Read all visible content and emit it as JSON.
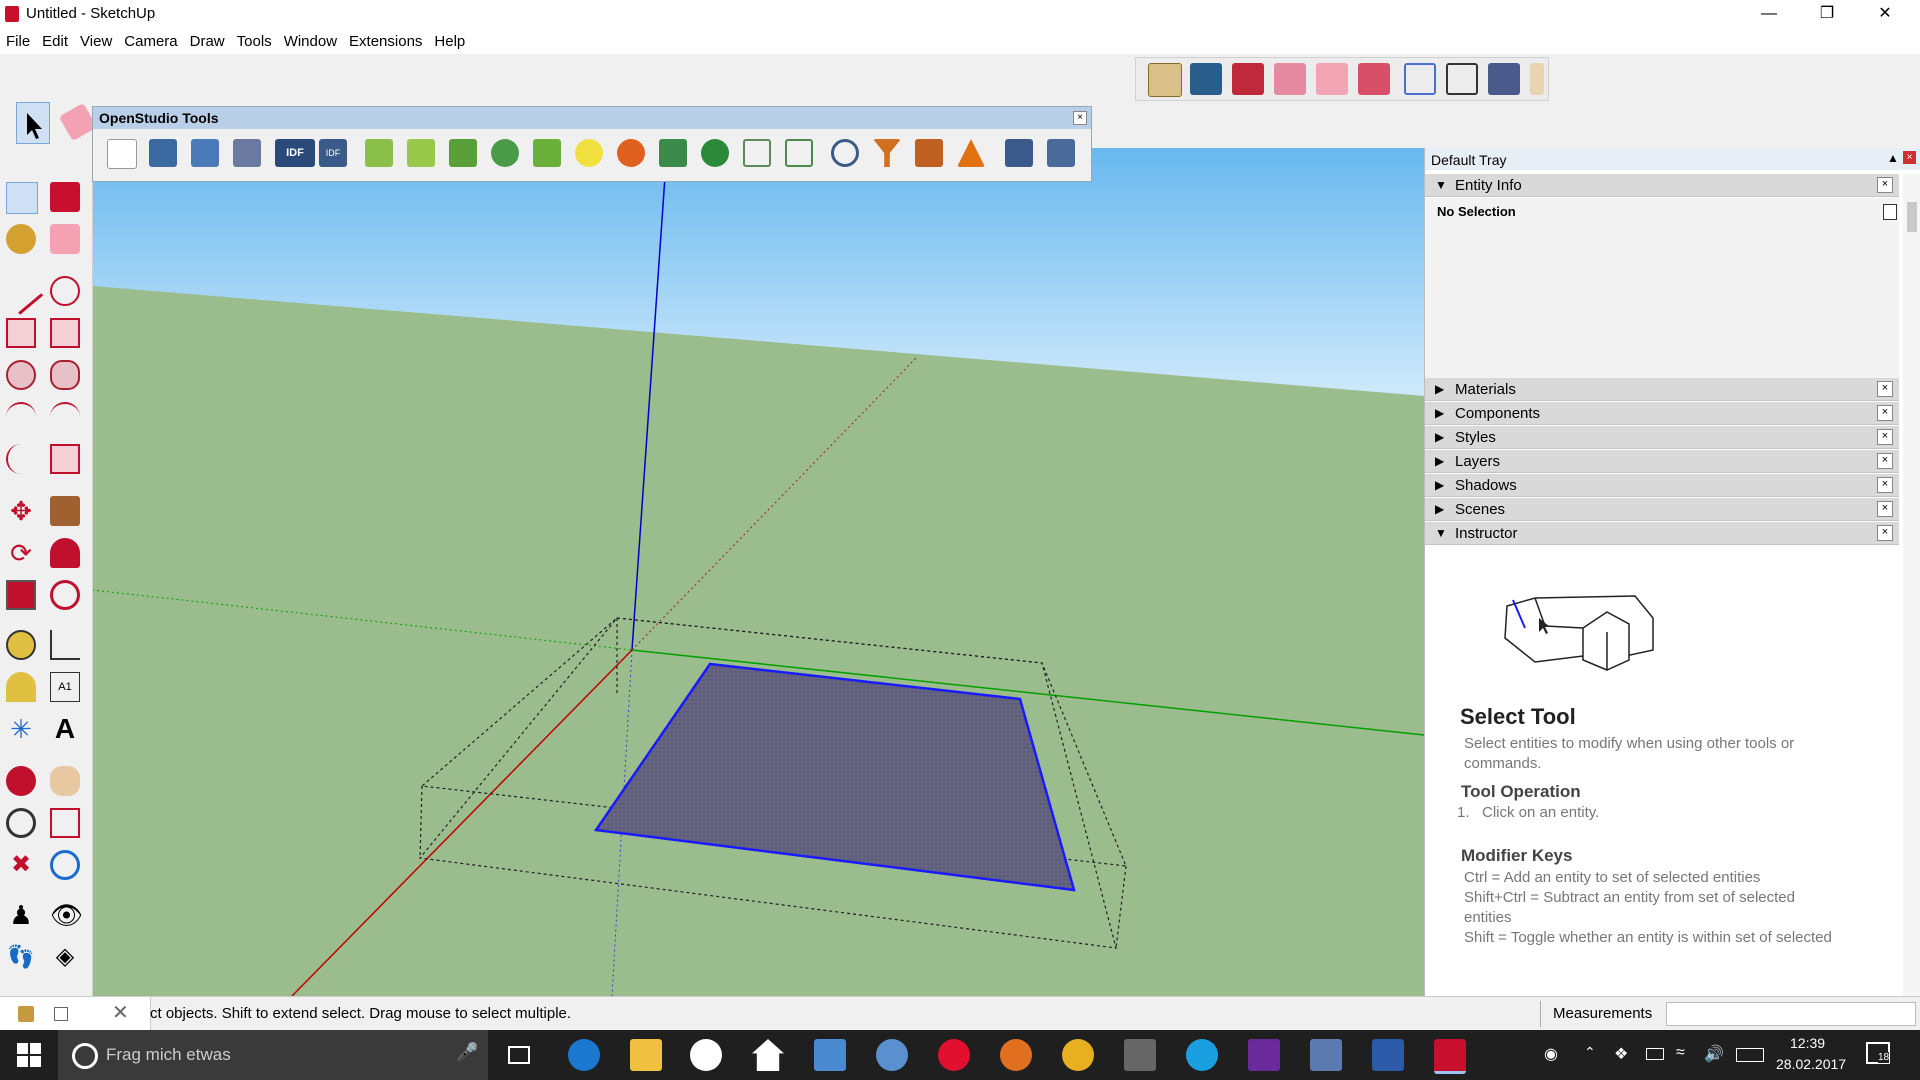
{
  "window": {
    "title": "Untitled - SketchUp"
  },
  "menu": [
    "File",
    "Edit",
    "View",
    "Camera",
    "Draw",
    "Tools",
    "Window",
    "Extensions",
    "Help"
  ],
  "openstudio": {
    "title": "OpenStudio Tools"
  },
  "tray": {
    "title": "Default Tray",
    "entity_info": {
      "label": "Entity Info",
      "selection": "No Selection"
    },
    "panels": [
      "Materials",
      "Components",
      "Styles",
      "Layers",
      "Shadows",
      "Scenes",
      "Instructor"
    ],
    "instructor": {
      "heading": "Select Tool",
      "description": "Select entities to modify when using other tools or commands.",
      "op_heading": "Tool Operation",
      "op_step": "Click on an entity.",
      "mod_heading": "Modifier Keys",
      "mod_lines": [
        "Ctrl = Add an entity to set of selected entities",
        "Shift+Ctrl = Subtract an entity from set of selected entities",
        "Shift = Toggle whether an entity is within set of selected"
      ]
    }
  },
  "status": {
    "text": "ct objects. Shift to extend select. Drag mouse to select multiple.",
    "measurements_label": "Measurements"
  },
  "taskbar": {
    "search_placeholder": "Frag mich etwas",
    "time": "12:39",
    "date": "28.02.2017",
    "notifications": "18"
  },
  "colors": {
    "sky": "#7fc4ef",
    "ground": "#9bbc8d",
    "face": "#5f5f7c",
    "edge_blue": "#1a1aff",
    "axis_red": "#c00000",
    "axis_green": "#00a000",
    "axis_blue": "#0000cc"
  }
}
